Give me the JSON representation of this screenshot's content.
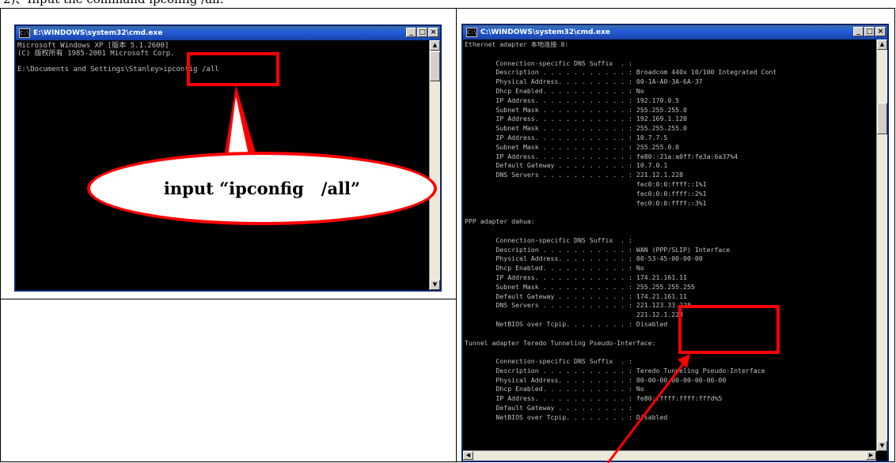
{
  "caption_partial": "2)、Input the command ipconfig /all.",
  "left_window": {
    "title": "E:\\WINDOWS\\system32\\cmd.exe",
    "lines": [
      "Microsoft Windows XP [版本 5.1.2600]",
      "(C) 版权所有 1985-2001 Microsoft Corp.",
      "",
      "E:\\Documents and Settings\\Stanley>ipconfig /all"
    ],
    "callout_text": "input “ipconfig   /all”"
  },
  "right_window": {
    "title": "C:\\WINDOWS\\system32\\cmd.exe",
    "lines": [
      "Ethernet adapter 本地连接 8:",
      "",
      "        Connection-specific DNS Suffix  . :",
      "        Description . . . . . . . . . . . : Broadcom 440x 10/100 Integrated Cont",
      "        Physical Address. . . . . . . . . : 00-1A-A0-3A-6A-37",
      "        Dhcp Enabled. . . . . . . . . . . : No",
      "        IP Address. . . . . . . . . . . . : 192.170.0.5",
      "        Subnet Mask . . . . . . . . . . . : 255.255.255.0",
      "        IP Address. . . . . . . . . . . . : 192.169.1.120",
      "        Subnet Mask . . . . . . . . . . . : 255.255.255.0",
      "        IP Address. . . . . . . . . . . . : 10.7.7.5",
      "        Subnet Mask . . . . . . . . . . . : 255.255.0.0",
      "        IP Address. . . . . . . . . . . . : fe80::21a:a0ff:fe3a:6a37%4",
      "        Default Gateway . . . . . . . . . : 10.7.0.1",
      "        DNS Servers . . . . . . . . . . . : 221.12.1.228",
      "                                            fec0:0:0:ffff::1%1",
      "                                            fec0:0:0:ffff::2%1",
      "                                            fec0:0:0:ffff::3%1",
      "",
      "PPP adapter dahua:",
      "",
      "        Connection-specific DNS Suffix  . :",
      "        Description . . . . . . . . . . . : WAN (PPP/SLIP) Interface",
      "        Physical Address. . . . . . . . . : 00-53-45-00-00-00",
      "        Dhcp Enabled. . . . . . . . . . . : No",
      "        IP Address. . . . . . . . . . . . : 174.21.161.11",
      "        Subnet Mask . . . . . . . . . . . : 255.255.255.255",
      "        Default Gateway . . . . . . . . . : 174.21.161.11",
      "        DNS Servers . . . . . . . . . . . : 221.123.33.228",
      "                                            221.12.1.228",
      "        NetBIOS over Tcpip. . . . . . . . : Disabled",
      "",
      "Tunnel adapter Teredo Tunneling Pseudo-Interface:",
      "",
      "        Connection-specific DNS Suffix  . :",
      "        Description . . . . . . . . . . . : Teredo Tunneling Pseudo-Interface",
      "        Physical Address. . . . . . . . . : 00-00-00-00-00-00-00-00",
      "        Dhcp Enabled. . . . . . . . . . . : No",
      "        IP Address. . . . . . . . . . . . : fe80::ffff:ffff:fffd%5",
      "        Default Gateway . . . . . . . . . :",
      "        NetBIOS over Tcpip. . . . . . . . : Disabled"
    ]
  },
  "window_buttons": {
    "minimize": "_",
    "maximize": "□",
    "close": "×"
  },
  "scroll_glyphs": {
    "up": "▲",
    "down": "▼",
    "left": "◀",
    "right": "▶"
  },
  "title_icon_glyph": "C:\\",
  "colors": {
    "highlight": "#ff0000",
    "console_bg": "#000000",
    "console_text": "#c0c0c0",
    "titlebar": "#245edb"
  }
}
